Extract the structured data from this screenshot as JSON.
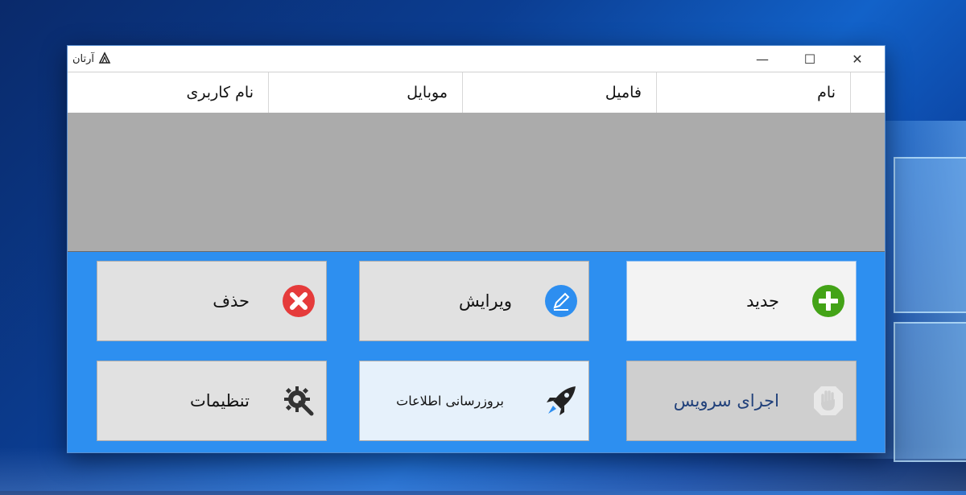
{
  "window": {
    "title": "آرتان",
    "controls": {
      "minimize": "—",
      "maximize": "☐",
      "close": "✕"
    }
  },
  "grid": {
    "columns": [
      "نام",
      "فامیل",
      "موبایل",
      "نام کاربری"
    ],
    "rows": []
  },
  "buttons": {
    "new": {
      "label": "جدید",
      "icon": "plus-circle-icon"
    },
    "edit": {
      "label": "ویرایش",
      "icon": "pencil-circle-icon"
    },
    "delete": {
      "label": "حذف",
      "icon": "x-circle-icon"
    },
    "service": {
      "label": "اجرای سرویس",
      "icon": "hand-stop-icon"
    },
    "update": {
      "label": "بروزرسانی اطلاعات",
      "icon": "rocket-icon"
    },
    "settings": {
      "label": "تنظیمات",
      "icon": "gear-wrench-icon"
    }
  },
  "colors": {
    "window_bg": "#2d8ff0",
    "grid_bg": "#ababab",
    "new_accent": "#43a317",
    "edit_accent": "#2d8ef0",
    "delete_accent": "#e53b3b"
  }
}
